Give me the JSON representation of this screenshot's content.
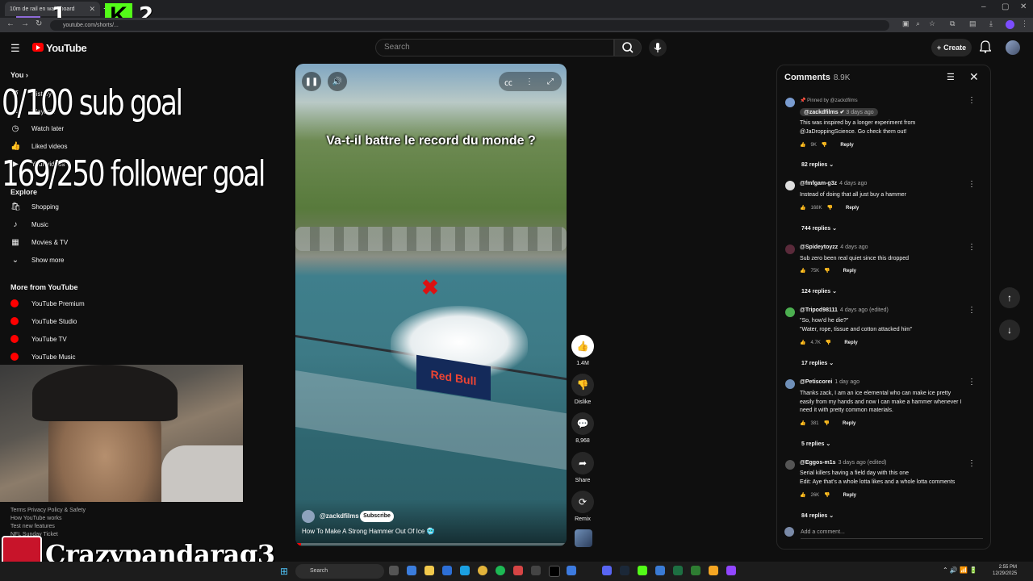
{
  "browser": {
    "tab_title": "10m de rail en wakeboard",
    "url": "youtube.com/shorts/...",
    "window_controls": [
      "–",
      "▢",
      "✕"
    ]
  },
  "header": {
    "logo_text": "YouTube",
    "search_placeholder": "Search",
    "create_label": "Create"
  },
  "sidebar": {
    "you_label": "You",
    "you_items": [
      {
        "label": "History",
        "icon": "history-icon"
      },
      {
        "label": "Playlists",
        "icon": "playlist-icon"
      },
      {
        "label": "Watch later",
        "icon": "clock-icon"
      },
      {
        "label": "Liked videos",
        "icon": "thumb-up-icon"
      },
      {
        "label": "Your videos",
        "icon": "video-icon"
      }
    ],
    "explore_label": "Explore",
    "explore_items": [
      {
        "label": "Shopping",
        "icon": "bag-icon"
      },
      {
        "label": "Music",
        "icon": "music-icon"
      },
      {
        "label": "Movies & TV",
        "icon": "film-icon"
      },
      {
        "label": "Show more",
        "icon": "chevron-down-icon"
      }
    ],
    "more_label": "More from YouTube",
    "more_items": [
      {
        "label": "YouTube Premium"
      },
      {
        "label": "YouTube Studio"
      },
      {
        "label": "YouTube TV"
      },
      {
        "label": "YouTube Music"
      }
    ],
    "footer": {
      "line1": "Terms  Privacy  Policy & Safety",
      "line2": "How YouTube works",
      "line3": "Test new features",
      "line4": "NFL Sunday Ticket"
    }
  },
  "stream_overlay": {
    "sub_goal": "0/100 sub goal",
    "follower_goal": "169/250 follower goal",
    "twitch_num": "1",
    "kick_letter": "K",
    "kick_num": "2",
    "streamer_name": "Crazypandarag3"
  },
  "video": {
    "caption": "Va-t-il battre le record du monde ?",
    "banner_text": "Red Bull",
    "channel": "@zackdfilms",
    "subscribe_label": "Subscribe",
    "title": "How To Make A Strong Hammer Out Of Ice 🥶",
    "progress": 0.02
  },
  "actions": {
    "like_count": "1.4M",
    "dislike_label": "Dislike",
    "comment_count": "8,968",
    "share_label": "Share",
    "remix_label": "Remix"
  },
  "comments": {
    "title": "Comments",
    "count": "8.9K",
    "pinned_label": "Pinned by @zackdfilms",
    "add_placeholder": "Add a comment...",
    "reply_label": "Reply",
    "items": [
      {
        "author": "@zackdfilms",
        "time": "3 days ago",
        "text": "This was inspired by a longer experiment from\n@JaDroppingScience. Go check them out!",
        "likes": "9K",
        "replies": "82 replies",
        "avatar_color": "#7a9cd0"
      },
      {
        "author": "@fmfgam-g3z",
        "time": "4 days ago",
        "text": "Instead of doing that all just buy a hammer",
        "likes": "168K",
        "replies": "744 replies",
        "avatar_color": "#dddddd"
      },
      {
        "author": "@Spideytoyzz",
        "time": "4 days ago",
        "text": "Sub zero been real quiet since this dropped",
        "likes": "75K",
        "replies": "124 replies",
        "avatar_color": "#5a2a3a"
      },
      {
        "author": "@Tripod98111",
        "time": "4 days ago (edited)",
        "text": "\"So, how'd he die?\"\n\"Water, rope, tissue and cotton attacked him\"",
        "likes": "4.7K",
        "replies": "17 replies",
        "avatar_color": "#4caf50"
      },
      {
        "author": "@Petiscorei",
        "time": "1 day ago",
        "text": "Thanks zack, I am an ice elemental who can make ice pretty\neasily from my hands and now I can make a hammer whenever I\nneed it with pretty common materials.",
        "likes": "381",
        "replies": "5 replies",
        "avatar_color": "#6f8fb8"
      },
      {
        "author": "@Eggos-m1s",
        "time": "3 days ago (edited)",
        "text": "Serial killers having a field day with this one\nEdit: Aye that's a whole lotta likes and a whole lotta comments",
        "likes": "26K",
        "replies": "84 replies",
        "avatar_color": "#555555"
      }
    ]
  },
  "taskbar": {
    "search_label": "Search",
    "time": "2:55 PM",
    "date": "12/29/2025"
  },
  "colors": {
    "accent": "#ff0000",
    "background": "#0f0f0f",
    "panel_border": "#272727"
  }
}
